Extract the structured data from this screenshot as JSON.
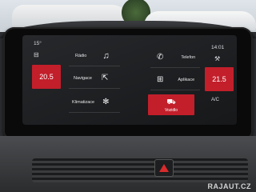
{
  "status": {
    "outside_temp": "15°",
    "clock": "14:01"
  },
  "climate": {
    "left_temp": "20.5",
    "right_temp": "21.5",
    "ac_label": "A/C"
  },
  "menu": {
    "radio": {
      "label": "Rádio",
      "icon": "music-note-icon"
    },
    "navigation": {
      "label": "Navigace",
      "icon": "navigation-icon"
    },
    "climate": {
      "label": "Klimatizace",
      "icon": "fan-icon"
    },
    "phone": {
      "label": "Telefon",
      "icon": "phone-icon"
    },
    "apps": {
      "label": "Aplikace",
      "icon": "apps-grid-icon"
    },
    "vehicle": {
      "label": "Vozidlo",
      "icon": "car-icon",
      "active": true
    }
  },
  "colors": {
    "accent": "#c21f2b",
    "screen_bg": "#1e2023"
  },
  "watermark": "RAJAUT.CZ"
}
